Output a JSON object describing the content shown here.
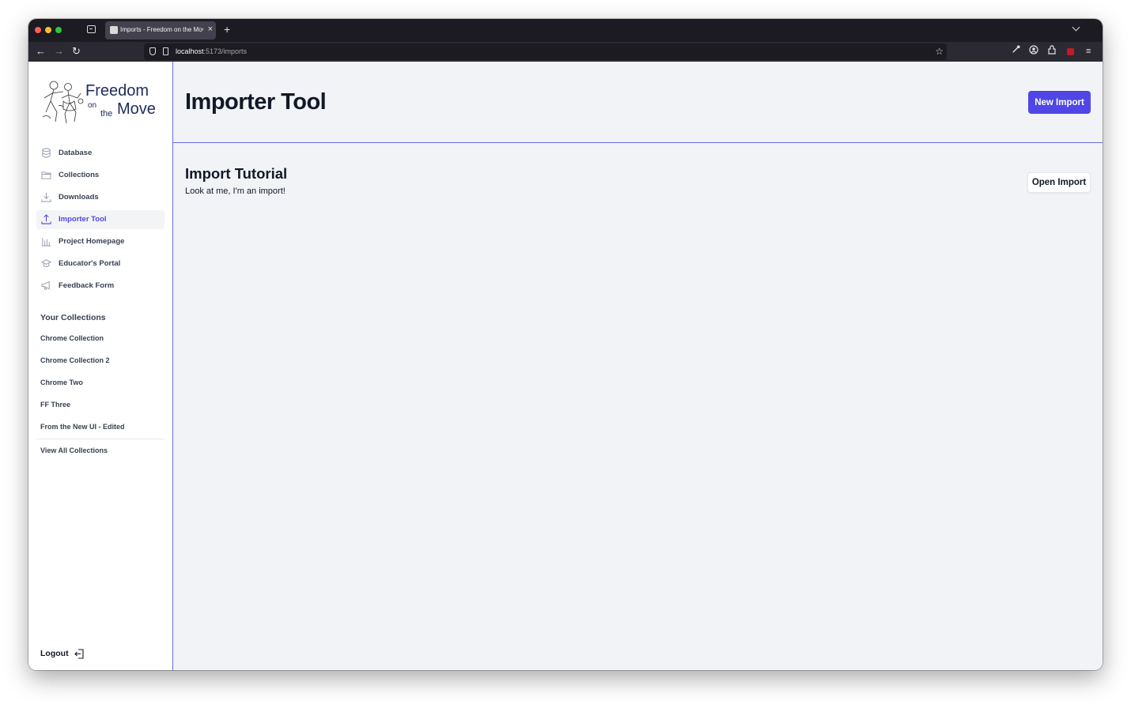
{
  "browser": {
    "tab_title": "Imports - Freedom on the Move",
    "tab_close": "×",
    "new_tab": "+",
    "url_host": "localhost",
    "url_path": ":5173/imports"
  },
  "logo": {
    "line1": "Freedom",
    "on": "on",
    "the": "the",
    "move": "Move"
  },
  "sidebar": {
    "items": [
      {
        "label": "Database",
        "icon": "database-icon",
        "active": false
      },
      {
        "label": "Collections",
        "icon": "folder-icon",
        "active": false
      },
      {
        "label": "Downloads",
        "icon": "download-icon",
        "active": false
      },
      {
        "label": "Importer Tool",
        "icon": "upload-icon",
        "active": true
      },
      {
        "label": "Project Homepage",
        "icon": "chart-icon",
        "active": false
      },
      {
        "label": "Educator's Portal",
        "icon": "graduation-cap-icon",
        "active": false
      },
      {
        "label": "Feedback Form",
        "icon": "megaphone-icon",
        "active": false
      }
    ],
    "collections_title": "Your Collections",
    "collections": [
      "Chrome Collection",
      "Chrome Collection 2",
      "Chrome Two",
      "FF Three",
      "From the New UI - Edited"
    ],
    "view_all": "View All Collections",
    "logout": "Logout"
  },
  "main": {
    "title": "Importer Tool",
    "new_import_label": "New Import",
    "imports": [
      {
        "name": "Import Tutorial",
        "description": "Look at me, I'm an import!",
        "action_label": "Open Import"
      }
    ]
  },
  "colors": {
    "accent": "#4f46e5",
    "divider": "#6e6cd8",
    "page_bg": "#f2f3f7"
  }
}
